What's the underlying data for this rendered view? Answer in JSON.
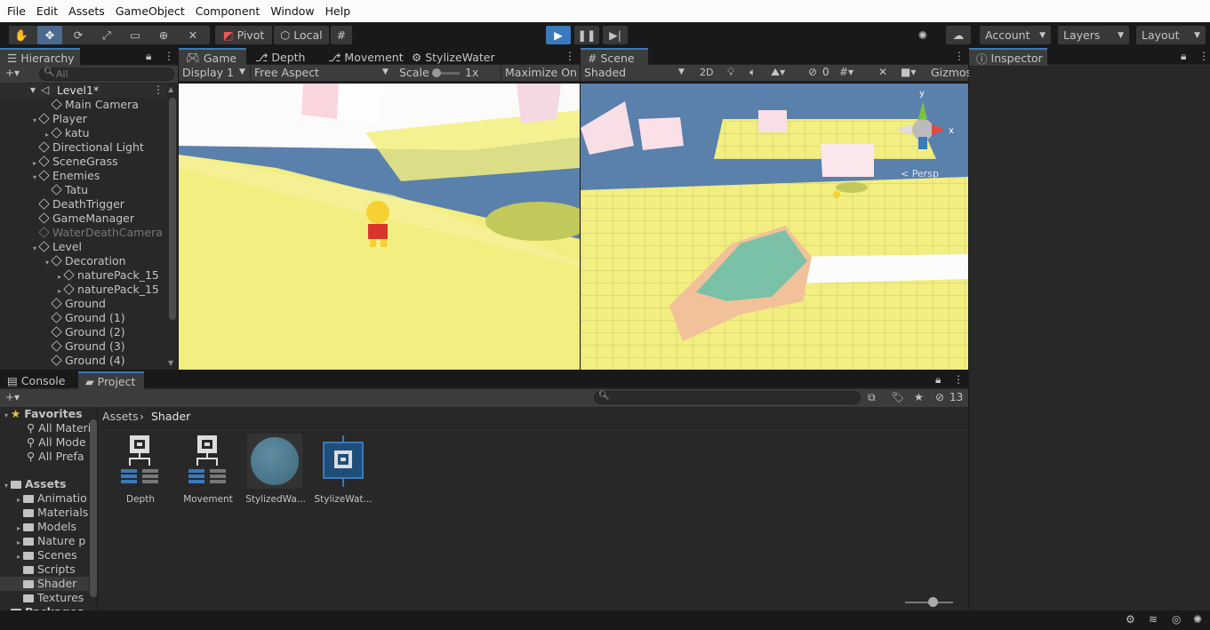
{
  "menu": {
    "file": "File",
    "edit": "Edit",
    "assets": "Assets",
    "gameobject": "GameObject",
    "component": "Component",
    "window": "Window",
    "help": "Help"
  },
  "toolbar": {
    "pivot": "Pivot",
    "local": "Local",
    "account": "Account",
    "layers": "Layers",
    "layout": "Layout"
  },
  "hierarchy": {
    "tab": "Hierarchy",
    "search_placeholder": "All",
    "scene": "Level1*",
    "items": [
      "Main Camera",
      "Player",
      "katu",
      "Directional Light",
      "SceneGrass",
      "Enemies",
      "Tatu",
      "DeathTrigger",
      "GameManager",
      "WaterDeathCamera",
      "Level",
      "Decoration",
      "naturePack_15",
      "naturePack_15",
      "Ground",
      "Ground (1)",
      "Ground (2)",
      "Ground (3)",
      "Ground (4)"
    ]
  },
  "game": {
    "tabs": [
      "Game",
      "Depth",
      "Movement",
      "StylizeWater"
    ],
    "display": "Display 1",
    "aspect": "Free Aspect",
    "scale_label": "Scale",
    "scale_value": "1x",
    "maximize": "Maximize On P"
  },
  "scene": {
    "tab": "Scene",
    "shading": "Shaded",
    "mode2d": "2D",
    "hidden_count": "0",
    "gizmos": "Gizmos",
    "persp": "Persp",
    "axis_y": "y",
    "axis_x": "x"
  },
  "inspector": {
    "tab": "Inspector"
  },
  "bottom": {
    "tabs": [
      "Console",
      "Project"
    ],
    "hidden_count": "13",
    "breadcrumb": [
      "Assets",
      "Shader"
    ],
    "favorites": {
      "label": "Favorites",
      "items": [
        "All Materi",
        "All Mode",
        "All Prefa"
      ]
    },
    "assets": {
      "label": "Assets",
      "items": [
        "Animatio",
        "Materials",
        "Models",
        "Nature p",
        "Scenes",
        "Scripts",
        "Shader",
        "Textures"
      ],
      "packages": "Packages"
    },
    "files": [
      "Depth",
      "Movement",
      "StylizedWa...",
      "StylizeWat..."
    ]
  },
  "colors": {
    "accent": "#3a79bb",
    "game_yellow": "#f2ee80",
    "sky_blue": "#5a80ac",
    "teal": "#7bc1a7",
    "peach": "#f2c199"
  }
}
